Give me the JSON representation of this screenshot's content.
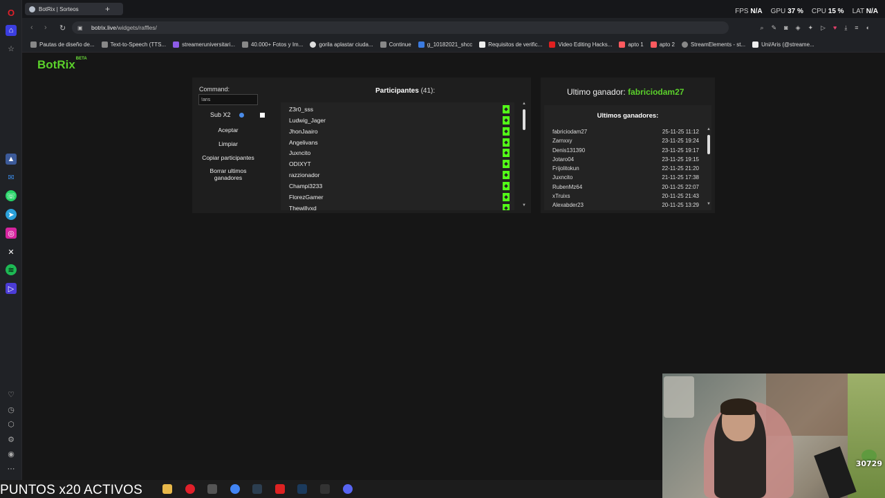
{
  "browser": {
    "tab_title": "BotRix | Sorteos",
    "new_tab_icon": "+",
    "url_host": "botrix.live",
    "url_path": "/widgets/raffles/",
    "hud": {
      "fps_label": "FPS",
      "fps_value": "N/A",
      "gpu_label": "GPU",
      "gpu_value": "37 %",
      "cpu_label": "CPU",
      "cpu_value": "15 %",
      "lat_label": "LAT",
      "lat_value": "N/A"
    },
    "bookmarks": [
      "Pautas de diseño de...",
      "Text-to-Speech (TTS...",
      "streameruniversitari...",
      "40.000+ Fotos y Im...",
      "gorila aplastar ciuda...",
      "Continue",
      "g_10182021_shcc",
      "Requisitos de verific...",
      "Video Editing Hacks...",
      "apto 1",
      "apto 2",
      "StreamElements - st...",
      "Uni/Aris (@streame..."
    ]
  },
  "app": {
    "logo": "BotRix",
    "logo_badge": "BETA",
    "command_label": "Command:",
    "command_value": "!aris",
    "sub_label": "Sub X2",
    "buttons": {
      "accept": "Aceptar",
      "clear": "Limpiar",
      "copy": "Copiar participantes",
      "delete_winners": "Borrar ultimos ganadores"
    },
    "participants_title": "Participantes",
    "participants_count": "(41):",
    "participants": [
      "Z3r0_sss",
      "Ludwig_Jager",
      "JhonJaairo",
      "Angelivans",
      "Juxncito",
      "ODIXYT",
      "razzionador",
      "Champi3233",
      "FlorezGamer",
      "Thewillyxd"
    ],
    "last_winner_label": "Ultimo ganador:",
    "last_winner_name": "fabriciodam27",
    "winners_title": "Ultimos ganadores:",
    "winners": [
      {
        "name": "fabriciodam27",
        "date": "25-11-25 11:12"
      },
      {
        "name": "Zarnxxy",
        "date": "23-11-25 19:24"
      },
      {
        "name": "Denis131390",
        "date": "23-11-25 19:17"
      },
      {
        "name": "Jotaro04",
        "date": "23-11-25 19:15"
      },
      {
        "name": "Frijolitokun",
        "date": "22-11-25 21:20"
      },
      {
        "name": "Juxncito",
        "date": "21-11-25 17:38"
      },
      {
        "name": "RubenMz64",
        "date": "20-11-25 22:07"
      },
      {
        "name": "xTruixs",
        "date": "20-11-25 21:43"
      },
      {
        "name": "Alexabder23",
        "date": "20-11-25 13:29"
      }
    ]
  },
  "overlay": {
    "banner": "PUNTOS x20 ACTIVOS",
    "webcam_badge": "30729"
  },
  "colors": {
    "brand_green": "#5bd12b",
    "kick_green": "#53fc18",
    "opera_red": "#e0202a"
  }
}
